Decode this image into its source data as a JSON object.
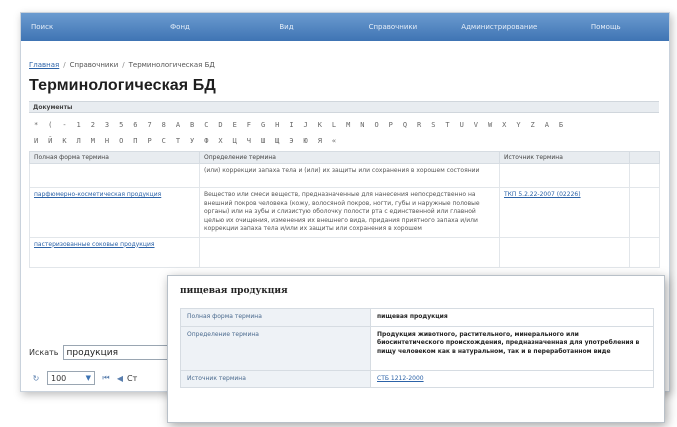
{
  "nav": [
    "Поиск",
    "Фонд",
    "Вид",
    "Справочники",
    "Администрирование",
    "Помощь"
  ],
  "breadcrumb": {
    "home": "Главная",
    "directories": "Справочники",
    "current": "Терминологическая БД"
  },
  "title": "Терминологическая БД",
  "section": "Документы",
  "alphabet_row1": [
    "*",
    "(",
    "-",
    "1",
    "2",
    "3",
    "5",
    "6",
    "7",
    "8",
    "A",
    "B",
    "C",
    "D",
    "E",
    "F",
    "G",
    "H",
    "I",
    "J",
    "K",
    "L",
    "M",
    "N",
    "O",
    "P",
    "Q",
    "R",
    "S",
    "T",
    "U",
    "V",
    "W",
    "X",
    "Y",
    "Z",
    "А",
    "Б"
  ],
  "alphabet_row2": [
    "И",
    "Й",
    "К",
    "Л",
    "М",
    "Н",
    "О",
    "П",
    "Р",
    "С",
    "Т",
    "У",
    "Ф",
    "Х",
    "Ц",
    "Ч",
    "Ш",
    "Щ",
    "Э",
    "Ю",
    "Я",
    "«"
  ],
  "table": {
    "headers": [
      "Полная форма термина",
      "Определение термина",
      "Источник термина"
    ],
    "rows": [
      {
        "term": "",
        "definition": "(или) коррекции запаха тела и (или) их защиты или сохранения в хорошем состоянии",
        "source": ""
      },
      {
        "term": "парфюмерно-косметическая продукция",
        "definition": "Вещество или смеси веществ, предназначенные для нанесения непосредственно на внешний покров человека (кожу, волосяной покров, ногти, губы и наружные половые органы) или на зубы и слизистую оболочку полости рта с единственной или главной целью их очищения, изменения их внешнего вида, придания приятного запаха и/или коррекции запаха тела и/или их защиты или сохранения в хорошем",
        "source": "ТКП 5.2.22-2007 (02226)"
      },
      {
        "term": "пастеризованные соковые продукция",
        "definition": "",
        "source": ""
      }
    ]
  },
  "search": {
    "label": "Искать",
    "value": "продукция"
  },
  "pager": {
    "page_size": "100",
    "prefix": "Ст"
  },
  "popup": {
    "title": "пищевая продукция",
    "rows": [
      {
        "key": "Полная форма термина",
        "value": "пищевая продукция"
      },
      {
        "key": "Определение термина",
        "value": "Продукция животного, растительного, минерального или биосинтетического происхождения, предназначенная для употребления в пищу человеком как в натуральном, так и в переработанном виде"
      },
      {
        "key": "Источник термина",
        "value": "СТБ 1212-2000"
      }
    ]
  },
  "icons": {
    "page-size-caret": "chevron-down-icon",
    "pager-first": "first-page-icon",
    "pager-prev": "prev-page-icon",
    "pager-refresh": "refresh-icon"
  }
}
